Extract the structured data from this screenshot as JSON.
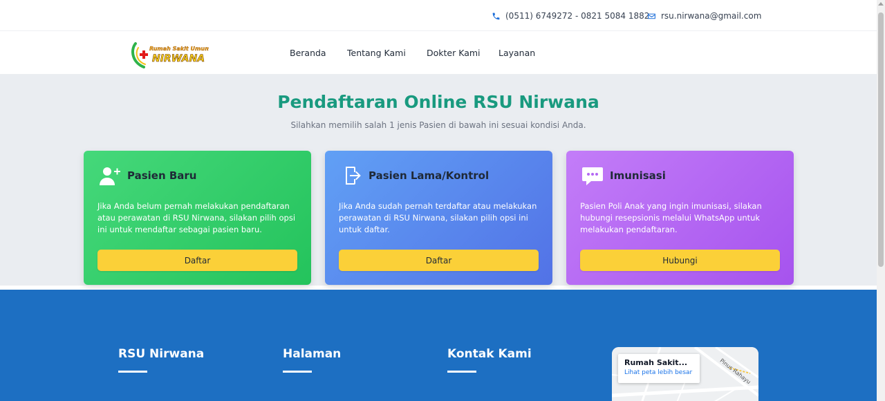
{
  "topbar": {
    "phone": "(0511) 6749272 - 0821 5084 1882",
    "email": "rsu.nirwana@gmail.com",
    "phone_icon": "phone-icon",
    "email_icon": "envelope-icon"
  },
  "logo": {
    "line1": "Rumah Sakit Umum",
    "line2": "NIRWANA"
  },
  "nav": {
    "items": [
      {
        "label": "Beranda"
      },
      {
        "label": "Tentang Kami"
      },
      {
        "label": "Dokter Kami"
      },
      {
        "label": "Layanan"
      }
    ]
  },
  "hero": {
    "title": "Pendaftaran Online RSU Nirwana",
    "subtitle": "Silahkan memilih salah 1 jenis Pasien di bawah ini sesuai kondisi Anda."
  },
  "cards": [
    {
      "icon": "user-plus-icon",
      "title": "Pasien Baru",
      "description": "Jika Anda belum pernah melakukan pendaftaran atau perawatan di RSU Nirwana, silakan pilih opsi ini untuk mendaftar sebagai pasien baru.",
      "button": "Daftar",
      "color": "#2ecc6a"
    },
    {
      "icon": "sign-in-icon",
      "title": "Pasien Lama/Kontrol",
      "description": "Jika Anda sudah pernah terdaftar atau melakukan perawatan di RSU Nirwana, silakan pilih opsi ini untuk daftar.",
      "button": "Daftar",
      "color": "#5a86ee"
    },
    {
      "icon": "chat-bubble-icon",
      "title": "Imunisasi",
      "description": "Pasien Poli Anak yang ingin imunisasi, silakan hubungi resepsionis melalui WhatsApp untuk melakukan pendaftaran.",
      "button": "Hubungi",
      "color": "#b468f3"
    }
  ],
  "footer": {
    "columns": [
      {
        "title": "RSU Nirwana"
      },
      {
        "title": "Halaman"
      },
      {
        "title": "Kontak Kami"
      }
    ],
    "map": {
      "place": "Rumah Sakit...",
      "link": "Lihat peta lebih besar",
      "street": "Pinus Rahayu"
    },
    "color": "#1d6fc2"
  },
  "colors": {
    "accent": "#199a7f",
    "button": "#fbd038",
    "hero_bg": "#eaedf1"
  }
}
